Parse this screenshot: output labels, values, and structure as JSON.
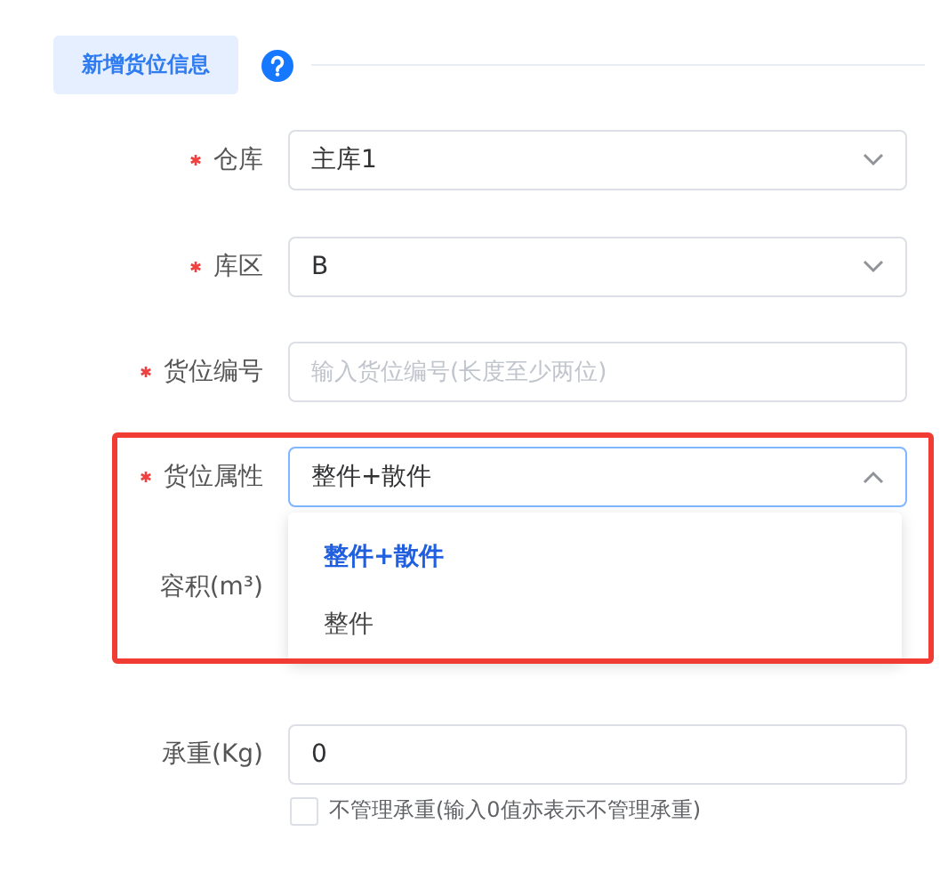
{
  "section_tab": {
    "label": "新增货位信息"
  },
  "fields": [
    {
      "kind": "select",
      "label": "仓库",
      "required": true,
      "value": "主库1",
      "expanded": false
    },
    {
      "kind": "select",
      "label": "库区",
      "required": true,
      "value": "B",
      "expanded": false
    },
    {
      "kind": "input",
      "label": "货位编号",
      "required": true,
      "placeholder": "输入货位编号(长度至少两位)"
    },
    {
      "kind": "select",
      "label": "货位属性",
      "required": true,
      "value": "整件+散件",
      "expanded": true,
      "highlighted": true,
      "options": [
        {
          "label": "整件+散件",
          "selected": true
        },
        {
          "label": "整件",
          "selected": false
        }
      ]
    },
    {
      "kind": "covered",
      "label": "容积(m³)",
      "required": false
    },
    {
      "kind": "input",
      "label": "承重(Kg)",
      "required": false,
      "value": "0"
    }
  ],
  "checkbox": {
    "label": "不管理承重(输入0值亦表示不管理承重)",
    "checked": false
  }
}
